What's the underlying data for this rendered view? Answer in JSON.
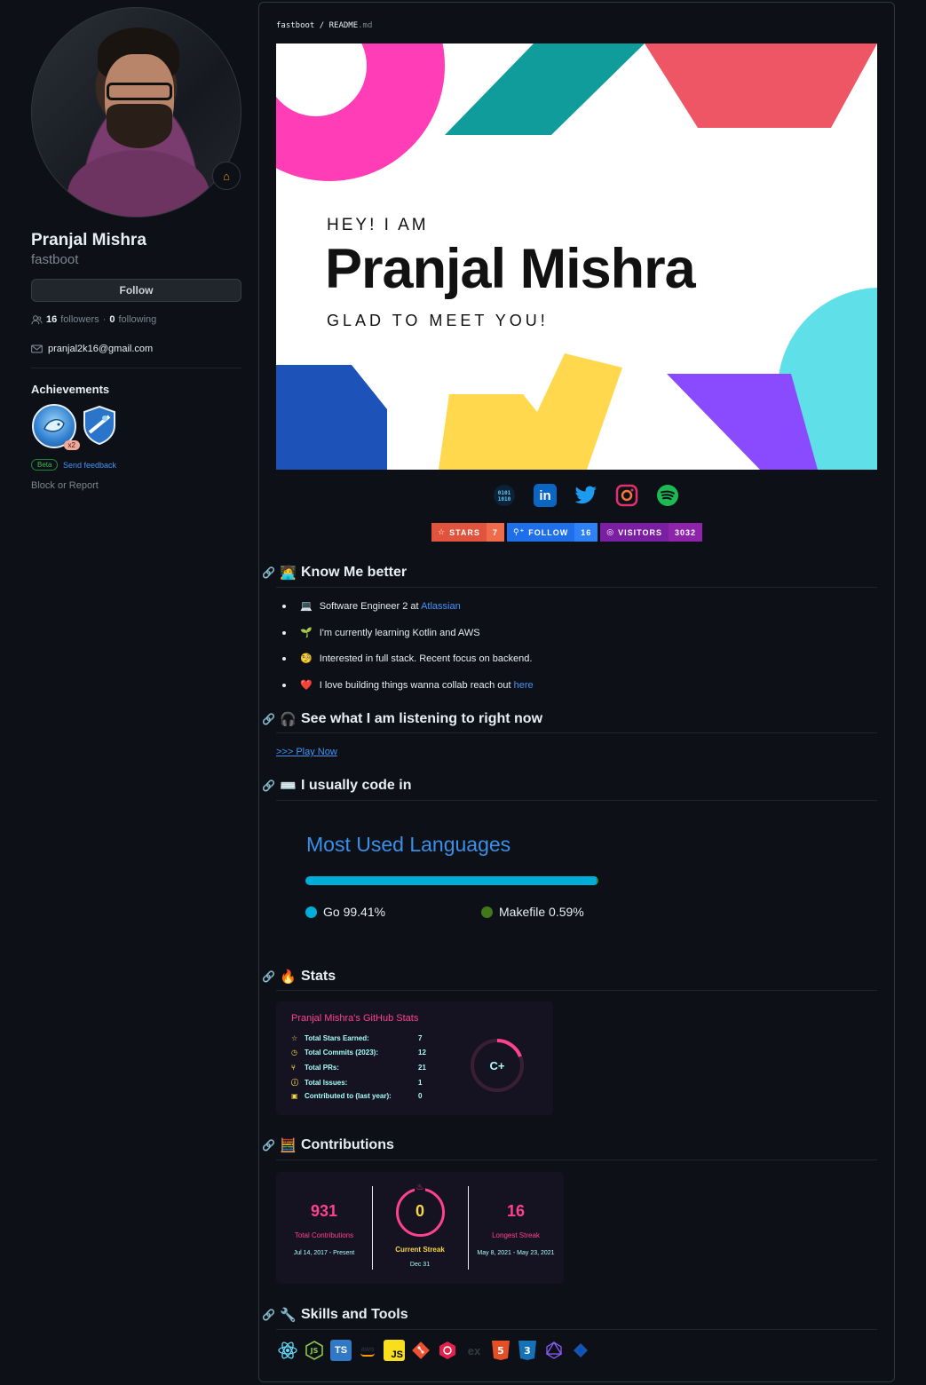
{
  "profile": {
    "name": "Pranjal Mishra",
    "username": "fastboot",
    "follow_label": "Follow",
    "followers_count": "16",
    "followers_label": "followers",
    "separator": "·",
    "following_count": "0",
    "following_label": "following",
    "email": "pranjal2k16@gmail.com",
    "achievements_title": "Achievements",
    "achievement_multiplier": "x2",
    "beta_label": "Beta",
    "feedback_label": "Send feedback",
    "block_label": "Block or Report"
  },
  "readme": {
    "repo": "fastboot",
    "sep": " / ",
    "file": "README",
    "ext": ".md"
  },
  "banner": {
    "greeting": "HEY! I AM",
    "name": "Pranjal Mishra",
    "tagline": "GLAD TO MEET YOU!"
  },
  "socials": [
    "dev-icon",
    "linkedin-icon",
    "twitter-icon",
    "instagram-icon",
    "spotify-icon"
  ],
  "shields": {
    "stars_label": "STARS",
    "stars_value": "7",
    "follow_label": "FOLLOW",
    "follow_value": "16",
    "visitors_label": "VISITORS",
    "visitors_value": "3032"
  },
  "sections": {
    "know_me": "Know Me better",
    "listening": "See what I am listening to right now",
    "code_in": "I usually code in",
    "stats": "Stats",
    "contributions": "Contributions",
    "skills": "Skills and Tools"
  },
  "know_me_items": [
    {
      "emoji": "💻",
      "text": "Software Engineer 2 at ",
      "link": "Atlassian"
    },
    {
      "emoji": "🌱",
      "text": "I'm currently learning Kotlin and AWS",
      "link": ""
    },
    {
      "emoji": "🧐",
      "text": "Interested in full stack. Recent focus on backend.",
      "link": ""
    },
    {
      "emoji": "❤️",
      "text": "I love building things wanna collab reach out ",
      "link": "here"
    }
  ],
  "play_now": ">>> Play Now",
  "languages": {
    "title": "Most Used Languages",
    "items": [
      {
        "name": "Go 99.41%",
        "color": "#00add8",
        "percent": 99.41
      },
      {
        "name": "Makefile 0.59%",
        "color": "#427819",
        "percent": 0.59
      }
    ]
  },
  "stats": {
    "title": "Pranjal Mishra's GitHub Stats",
    "rows": [
      {
        "label": "Total Stars Earned:",
        "value": "7"
      },
      {
        "label": "Total Commits (2023):",
        "value": "12"
      },
      {
        "label": "Total PRs:",
        "value": "21"
      },
      {
        "label": "Total Issues:",
        "value": "1"
      },
      {
        "label": "Contributed to (last year):",
        "value": "0"
      }
    ],
    "grade": "C+"
  },
  "contributions": {
    "total": "931",
    "total_label": "Total Contributions",
    "total_range": "Jul 14, 2017 - Present",
    "current": "0",
    "current_label": "Current Streak",
    "current_date": "Dec 31",
    "longest": "16",
    "longest_label": "Longest Streak",
    "longest_range": "May 8, 2021 - May 23, 2021"
  },
  "skills": [
    "react-icon",
    "nodejs-icon",
    "typescript-icon",
    "aws-icon",
    "javascript-icon",
    "git-icon",
    "nestjs-icon",
    "express-icon",
    "html5-icon",
    "css3-icon",
    "graphql-icon",
    "jira-icon"
  ],
  "skill_texts": {
    "ts": "TS",
    "aws": "aws",
    "js": "JS",
    "ex": "ex"
  },
  "colors": {
    "accent": "#4493f8",
    "stats_pink": "#fe428e",
    "stats_yellow": "#f8d847",
    "stats_cyan": "#a9fef7"
  }
}
